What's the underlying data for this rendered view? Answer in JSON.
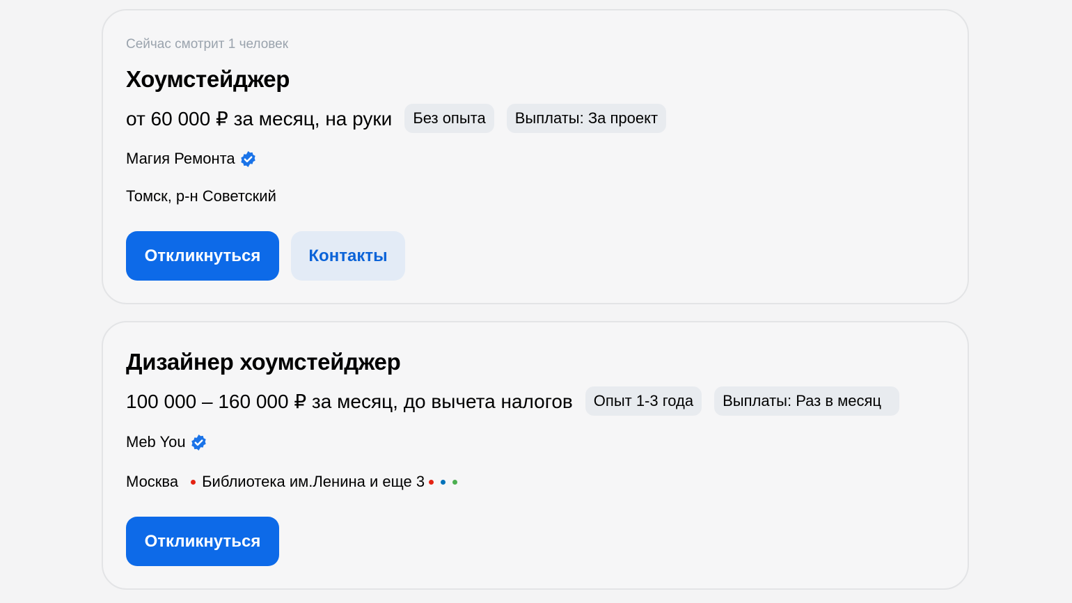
{
  "vacancies": [
    {
      "viewers": "Сейчас смотрит 1 человек",
      "title": "Хоумстейджер",
      "salary": "от 60 000 ₽ за месяц, на руки",
      "tags": [
        "Без опыта",
        "Выплаты: За проект"
      ],
      "company": "Магия Ремонта",
      "location": "Томск, р-н Советский",
      "respond_label": "Откликнуться",
      "contacts_label": "Контакты"
    },
    {
      "title": "Дизайнер хоумстейджер",
      "salary": "100 000 – 160 000 ₽ за месяц, до вычета налогов",
      "tags": [
        "Опыт 1-3 года",
        "Выплаты: Раз в месяц"
      ],
      "company": "Meb You",
      "city": "Москва",
      "metro": "Библиотека им.Ленина и еще 3",
      "metro_colors": [
        "#e42313",
        "#e42313",
        "#0072ba",
        "#4caf50"
      ],
      "respond_label": "Откликнуться"
    }
  ],
  "colors": {
    "accent": "#0d6ae8",
    "verified": "#1a73e8"
  }
}
